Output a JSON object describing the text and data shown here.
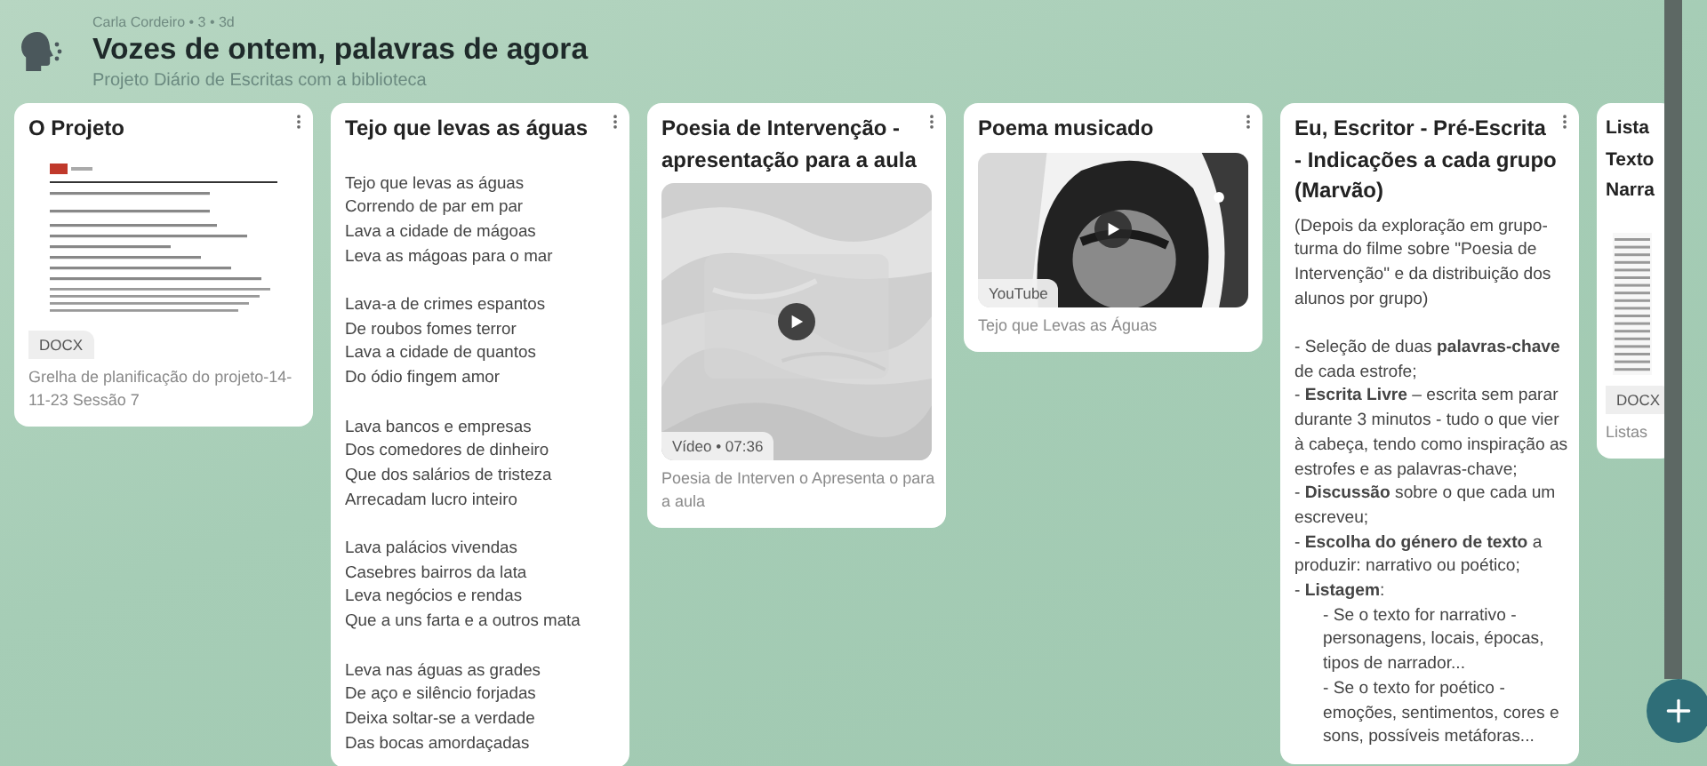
{
  "board": {
    "meta": "Carla Cordeiro • 3 • 3d",
    "title": "Vozes de ontem, palavras de agora",
    "subtitle": "Projeto Diário de Escritas com a biblioteca"
  },
  "posts": [
    {
      "kind": "document",
      "title": "O Projeto",
      "badge": "DOCX",
      "caption": "Grelha de planificação do projeto-14-11-23 Sessão 7"
    },
    {
      "kind": "poem",
      "title": "Tejo que levas as águas",
      "blocks": [
        [
          "Tejo que levas as águas",
          "Correndo de par em par",
          "Lava a cidade de mágoas",
          "Leva as mágoas para o mar"
        ],
        [
          "Lava-a de crimes espantos",
          "De roubos fomes terror",
          "Lava a cidade de quantos",
          "Do ódio fingem amor"
        ],
        [
          "Lava bancos e empresas",
          "Dos comedores de dinheiro",
          "Que dos salários de tristeza",
          "Arrecadam lucro inteiro"
        ],
        [
          "Lava palácios vivendas",
          "Casebres bairros da lata",
          "Leva negócios e rendas",
          "Que a uns farta e a outros mata"
        ],
        [
          "Leva nas águas as grades",
          "De aço e silêncio forjadas",
          "Deixa soltar-se a verdade",
          "Das bocas amordaçadas"
        ]
      ]
    },
    {
      "kind": "video",
      "title": "Poesia de Intervenção - apresentação para a aula",
      "badge": "Vídeo • 07:36",
      "caption": "Poesia de Interven o Apresenta o para a aula"
    },
    {
      "kind": "youtube",
      "title": "Poema musicado",
      "badge": "YouTube",
      "caption": "Tejo que Levas as Águas"
    },
    {
      "kind": "note",
      "title": "Eu, Escritor - Pré-Escrita - Indicações a cada grupo (Marvão)",
      "blocks": [
        [
          {
            "text": "(Depois da exploração em grupo-turma do filme sobre \"Poesia de Intervenção\" e da distribuição dos alunos por grupo)",
            "indented": false
          }
        ],
        [
          {
            "text": "- Seleção de duas **palavras-chave** de cada estrofe;",
            "indented": false
          },
          {
            "text": "- **Escrita Livre** – escrita sem parar durante 3 minutos - tudo o que vier à cabeça, tendo como inspiração as estrofes e as palavras-chave;",
            "indented": false
          },
          {
            "text": "- **Discussão** sobre o que cada um escreveu;",
            "indented": false
          },
          {
            "text": "- **Escolha do género de texto** a produzir: narrativo ou poético;",
            "indented": false
          },
          {
            "text": "- **Listagem**:",
            "indented": false
          },
          {
            "text": "- Se o texto for narrativo - personagens, locais, épocas, tipos de narrador...",
            "indented": true
          },
          {
            "text": "- Se o texto for poético - emoções, sentimentos, cores e sons, possíveis metáforas...",
            "indented": true
          }
        ]
      ]
    },
    {
      "kind": "document",
      "title_lines": [
        "Lista",
        "Texto",
        "Narra"
      ],
      "badge": "DOCX",
      "caption": "Listas"
    }
  ]
}
